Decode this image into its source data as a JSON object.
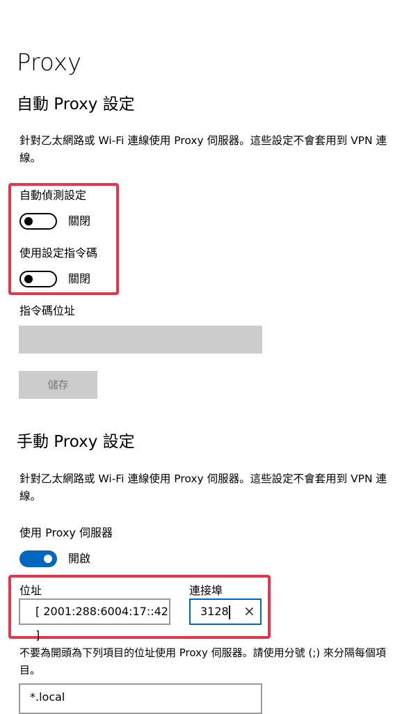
{
  "page": {
    "title": "Proxy"
  },
  "auto": {
    "section_title": "自動 Proxy 設定",
    "description": "針對乙太網路或 Wi-Fi 連線使用 Proxy 伺服器。這些設定不會套用到 VPN 連線。",
    "auto_detect": {
      "label": "自動偵測設定",
      "state": "關閉"
    },
    "use_script": {
      "label": "使用設定指令碼",
      "state": "關閉"
    },
    "script_address": {
      "label": "指令碼位址",
      "value": ""
    },
    "save_label": "儲存"
  },
  "manual": {
    "section_title": "手動 Proxy 設定",
    "description": "針對乙太網路或 Wi-Fi 連線使用 Proxy 伺服器。這些設定不會套用到 VPN 連線。",
    "use_proxy": {
      "label": "使用 Proxy 伺服器",
      "state": "開啟"
    },
    "address": {
      "label": "位址",
      "value": "[ 2001:288:6004:17::42 ]"
    },
    "port": {
      "label": "連接埠",
      "value": "3128"
    },
    "exceptions": {
      "description": "不要為開頭為下列項目的位址使用 Proxy 伺服器。請使用分號 (;) 來分隔每個項目。",
      "value": "*.local"
    }
  },
  "colors": {
    "accent": "#0067c0",
    "highlight": "#e8344a",
    "disabled": "#cccccc"
  }
}
